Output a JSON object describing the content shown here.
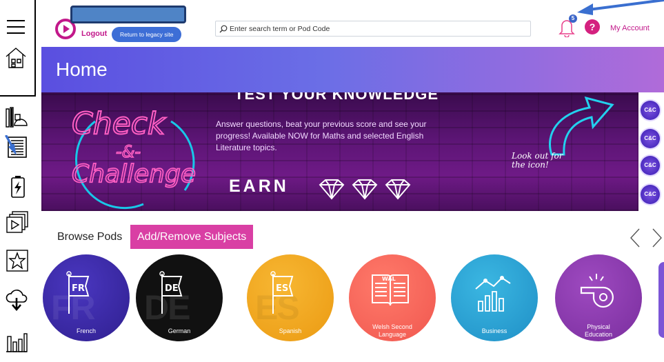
{
  "header": {
    "logout_label": "Logout",
    "legacy_label": "Return to legacy site",
    "search_placeholder": "Enter search term or Pod Code",
    "notification_count": "5",
    "help_label": "?",
    "account_label": "My Account"
  },
  "title": "Home",
  "banner": {
    "headline": "TEST YOUR KNOWLEDGE",
    "logo_line1": "Check",
    "logo_line2": "-&-",
    "logo_line3": "Challenge",
    "promo_text": "Answer questions, beat your previous score and see your progress! Available NOW for Maths and selected English Literature topics.",
    "earn_label": "EARN",
    "lookout_line1": "Look out for",
    "lookout_line2": "the icon!",
    "cc_badge": "C&C"
  },
  "browse": {
    "title": "Browse Pods",
    "add_remove_label": "Add/Remove Subjects",
    "pods": [
      {
        "name": "French",
        "code": "FR",
        "color": "#3d2aa8"
      },
      {
        "name": "German",
        "code": "DE",
        "color": "#111111"
      },
      {
        "name": "Spanish",
        "code": "ES",
        "color": "#f2a81d"
      },
      {
        "name_line1": "Welsh Second",
        "name_line2": "Language",
        "code": "WAL",
        "color": "#f4665c"
      },
      {
        "name": "Business",
        "color": "#2aa5d6"
      },
      {
        "name_line1": "Physical",
        "name_line2": "Education",
        "color": "#8e3fb0"
      }
    ]
  },
  "colors": {
    "accent_pink": "#d93fa4",
    "title_gradient_start": "#5a4fe0",
    "title_gradient_end": "#b06bd9",
    "legacy_blue": "#3d6ed6"
  },
  "rail_icons": [
    "menu-icon",
    "home-icon",
    "stationery-icon",
    "document-icon",
    "battery-bolt-icon",
    "play-cards-icon",
    "star-icon",
    "cloud-download-icon",
    "bar-chart-icon"
  ]
}
